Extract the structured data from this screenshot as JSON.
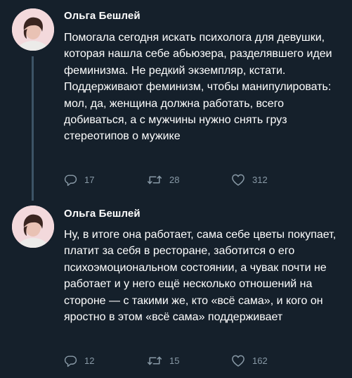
{
  "tweets": [
    {
      "author": "Ольга Бешлей",
      "text": "Помогала сегодня искать психолога для девушки, которая нашла себе абьюзера, разделявшего идеи феминизма. Не редкий экземпляр, кстати. Поддерживают феминизм, чтобы манипулировать: мол, да, женщина должна работать, всего добиваться, а с мужчины нужно снять груз стереотипов о мужике",
      "replies": "17",
      "retweets": "28",
      "likes": "312"
    },
    {
      "author": "Ольга Бешлей",
      "text": "Ну, в итоге она работает, сама себе цветы покупает, платит за себя в ресторане, заботится о его психоэмоциональном состоянии, а чувак почти не работает и у него ещё несколько отношений на стороне — с такими же, кто «всё сама», и кого он яростно в этом «всё сама» поддерживает",
      "replies": "12",
      "retweets": "15",
      "likes": "162"
    }
  ],
  "colors": {
    "background": "#15202b",
    "text": "#ffffff",
    "secondary": "#8899a6",
    "thread_line": "#3d5466"
  },
  "icons": [
    "reply-icon",
    "retweet-icon",
    "like-icon"
  ]
}
